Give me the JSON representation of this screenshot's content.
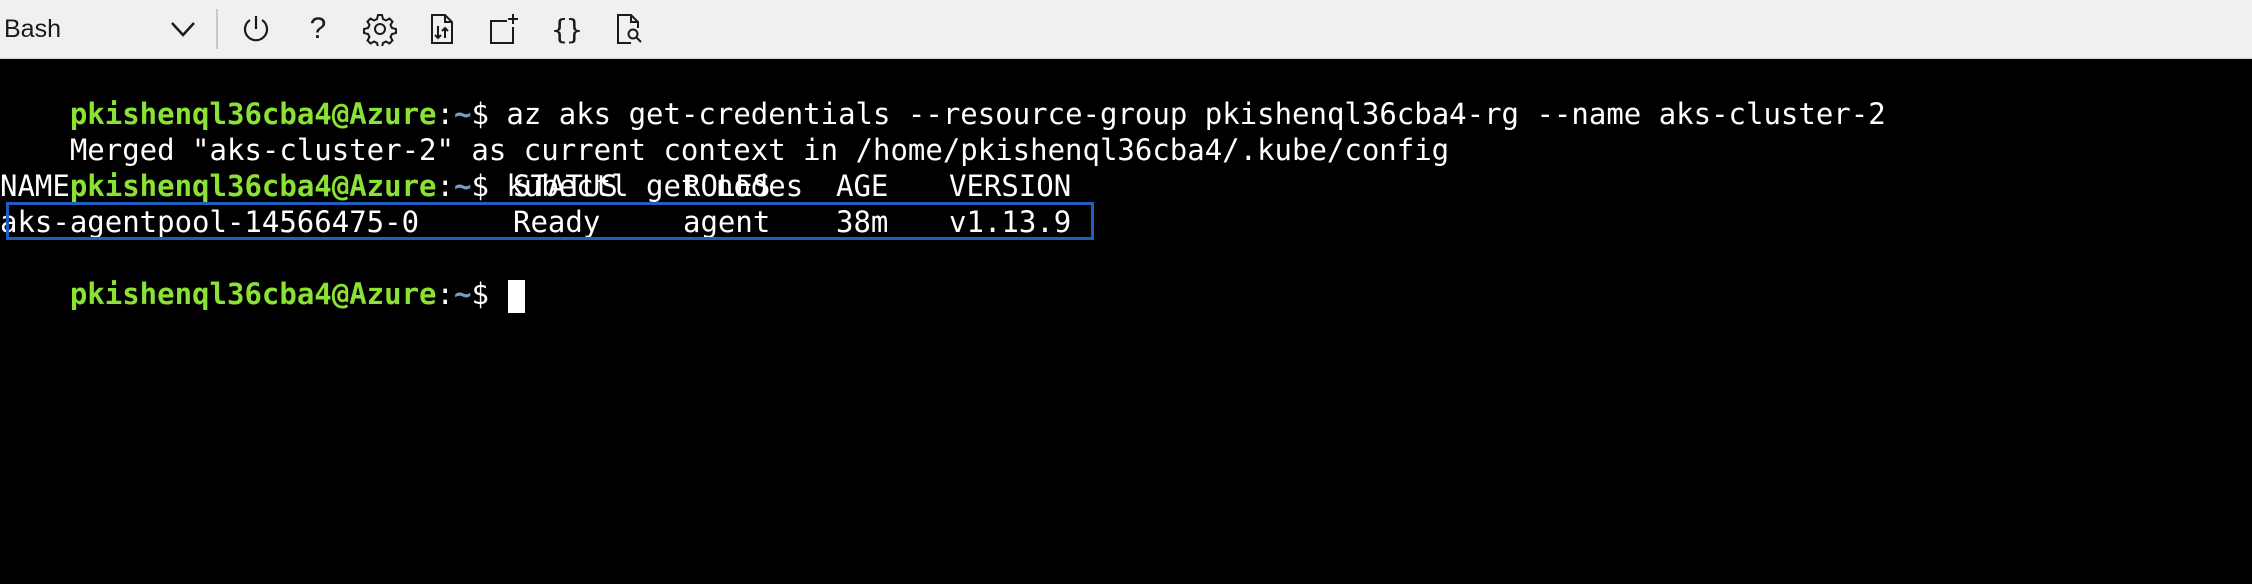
{
  "toolbar": {
    "shell_selector": {
      "value": "Bash",
      "icon": "chevron-down-icon"
    },
    "buttons": [
      {
        "name": "restart",
        "icon": "power-icon"
      },
      {
        "name": "help",
        "icon": "question-icon",
        "glyph": "?"
      },
      {
        "name": "settings",
        "icon": "gear-icon"
      },
      {
        "name": "upload-download",
        "icon": "file-transfer-icon"
      },
      {
        "name": "new-session",
        "icon": "new-session-icon"
      },
      {
        "name": "editor",
        "icon": "braces-icon",
        "glyph": "{}"
      },
      {
        "name": "web-preview",
        "icon": "file-preview-icon"
      }
    ]
  },
  "colors": {
    "prompt_user": "#8ae234",
    "prompt_path": "#729fcf",
    "highlight_border": "#1e5fbf",
    "toolbar_bg": "#f0f0f0",
    "terminal_bg": "#000000"
  },
  "terminal": {
    "prompt": {
      "user_host": "pkishenql36cba4@Azure",
      "colon": ":",
      "path": "~",
      "symbol": "$"
    },
    "line1": {
      "command": " az aks get-credentials --resource-group pkishenql36cba4-rg --name aks-cluster-2"
    },
    "line2": {
      "output": "Merged \"aks-cluster-2\" as current context in /home/pkishenql36cba4/.kube/config"
    },
    "line3": {
      "command": " kubectl get nodes"
    },
    "table": {
      "headers": {
        "name": "NAME",
        "status": "STATUS",
        "roles": "ROLES",
        "age": "AGE",
        "version": "VERSION"
      },
      "rows": [
        {
          "name": "aks-agentpool-14566475-0",
          "status": "Ready",
          "roles": "agent",
          "age": "38m",
          "version": "v1.13.9"
        }
      ]
    }
  }
}
